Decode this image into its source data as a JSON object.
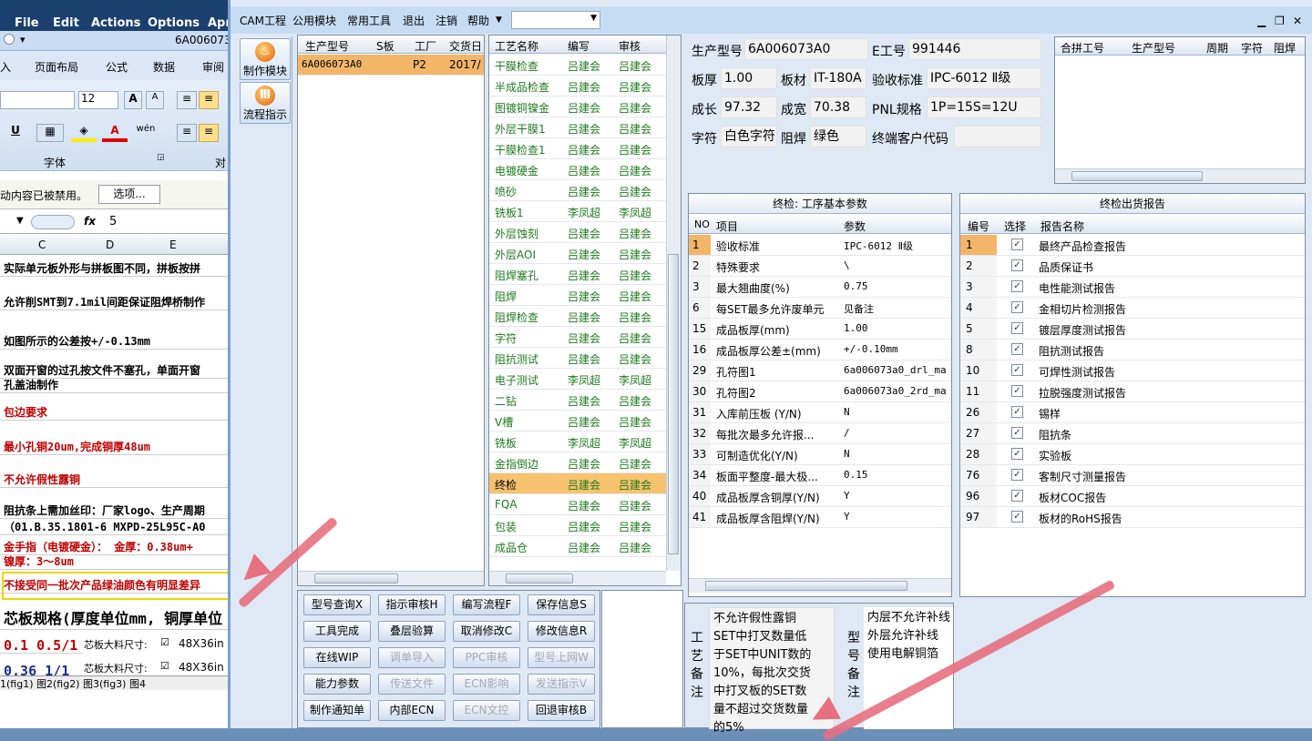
{
  "excel": {
    "menu": [
      "File",
      "Edit",
      "Actions",
      "Options",
      "Apr"
    ],
    "qat_title": "6A006073",
    "ribbon_tabs": [
      "入",
      "页面布局",
      "公式",
      "数据",
      "审阅"
    ],
    "font_size": "12",
    "group_font": "字体",
    "group_align": "对",
    "security_msg": "动内容已被禁用。",
    "options_btn": "选项...",
    "cell_value": "5",
    "fx": "fx",
    "columns": [
      "C",
      "D",
      "E"
    ],
    "rows": [
      {
        "text": "实际单元板外形与拼板图不同，拼板按拼",
        "red": false
      },
      {
        "text": "允许削SMT到7.1mil间距保证阻焊桥制作",
        "red": false
      },
      {
        "text": "如图所示的公差按+/-0.13mm",
        "red": false
      },
      {
        "text": "双面开窗的过孔按文件不塞孔，单面开窗",
        "red": false
      },
      {
        "text": "孔盖油制作",
        "red": false
      },
      {
        "text": "包边要求",
        "red": true
      },
      {
        "text": "最小孔铜20um,完成铜厚48um",
        "red": true
      },
      {
        "text": "不允许假性露铜",
        "red": true
      },
      {
        "text": "阻抗条上需加丝印：厂家logo、生产周期",
        "red": false
      },
      {
        "text": "（01.B.35.1801-6 MXPD-25L95C-A0",
        "red": false
      },
      {
        "text": "金手指（电镀硬金）： 金厚：0.38um+",
        "red": true
      },
      {
        "text": "镍厚：3～8um",
        "red": true
      },
      {
        "text": "不接受同一批次产品绿油颜色有明显差异",
        "red": true
      },
      {
        "text": "芯板规格(厚度单位mm, 铜厚单位",
        "red": false
      },
      {
        "text": "0.1  0.5/1",
        "red": true
      },
      {
        "text": "0.36 1/1",
        "red": false
      }
    ],
    "core_label": "芯板大料尺寸:",
    "core_val": "48X36in",
    "sheet_tabs": "1(fig1)  图2(fig2)  图3(fig3)  图4"
  },
  "cam": {
    "menu": [
      "CAM工程",
      "公用模块",
      "常用工具",
      "退出",
      "注销",
      "帮助"
    ],
    "toolbar": [
      {
        "label": "制作模块"
      },
      {
        "label": "流程指示"
      }
    ],
    "models": {
      "headers": [
        "生产型号",
        "S板",
        "工厂",
        "交货日"
      ],
      "rows": [
        {
          "model": "6A006073A0",
          "s": "",
          "factory": "P2",
          "date": "2017/"
        }
      ]
    },
    "process": {
      "headers": [
        "工艺名称",
        "编写",
        "审核"
      ],
      "rows": [
        [
          "干膜检查",
          "吕建会",
          "吕建会"
        ],
        [
          "半成品检查",
          "吕建会",
          "吕建会"
        ],
        [
          "图镀铜镍金",
          "吕建会",
          "吕建会"
        ],
        [
          "外层干膜1",
          "吕建会",
          "吕建会"
        ],
        [
          "干膜检查1",
          "吕建会",
          "吕建会"
        ],
        [
          "电镀硬金",
          "吕建会",
          "吕建会"
        ],
        [
          "喷砂",
          "吕建会",
          "吕建会"
        ],
        [
          "铣板1",
          "李凤超",
          "李凤超"
        ],
        [
          "外层蚀刻",
          "吕建会",
          "吕建会"
        ],
        [
          "外层AOI",
          "吕建会",
          "吕建会"
        ],
        [
          "阻焊塞孔",
          "吕建会",
          "吕建会"
        ],
        [
          "阻焊",
          "吕建会",
          "吕建会"
        ],
        [
          "阻焊检查",
          "吕建会",
          "吕建会"
        ],
        [
          "字符",
          "吕建会",
          "吕建会"
        ],
        [
          "阻抗测试",
          "吕建会",
          "吕建会"
        ],
        [
          "电子测试",
          "李凤超",
          "李凤超"
        ],
        [
          "二钻",
          "吕建会",
          "吕建会"
        ],
        [
          "V槽",
          "吕建会",
          "吕建会"
        ],
        [
          "铣板",
          "李凤超",
          "李凤超"
        ],
        [
          "金指倒边",
          "吕建会",
          "吕建会"
        ],
        [
          "终检",
          "吕建会",
          "吕建会"
        ],
        [
          "FQA",
          "吕建会",
          "吕建会"
        ],
        [
          "包装",
          "吕建会",
          "吕建会"
        ],
        [
          "成品仓",
          "吕建会",
          "吕建会"
        ]
      ],
      "selected_index": 20
    },
    "buttons": [
      [
        "型号查询X",
        "指示审核H",
        "编写流程F",
        "保存信息S"
      ],
      [
        "工具完成",
        "叠层验算",
        "取消修改C",
        "修改信息R"
      ],
      [
        "在线WIP",
        "调单导入",
        "PPC审核",
        "型号上网W"
      ],
      [
        "能力参数",
        "传送文件",
        "ECN影响",
        "发送指示V"
      ],
      [
        "制作通知单",
        "内部ECN",
        "ECN文控",
        "回退审核B"
      ]
    ],
    "disabled_buttons": [
      "调单导入",
      "PPC审核",
      "型号上网W",
      "传送文件",
      "ECN影响",
      "发送指示V",
      "ECN文控"
    ],
    "info": {
      "model_label": "生产型号",
      "model": "6A006073A0",
      "eng_label": "E工号",
      "eng": "991446",
      "thick_label": "板厚",
      "thick": "1.00",
      "material_label": "板材",
      "material": "IT-180A",
      "std_label": "验收标准",
      "std": "IPC-6012 Ⅱ级",
      "len_label": "成长",
      "len": "97.32",
      "wid_label": "成宽",
      "wid": "70.38",
      "pnl_label": "PNL规格",
      "pnl": "1P=15S=12U",
      "char_label": "字符",
      "char": "白色字符",
      "mask_label": "阻焊",
      "mask": "绿色",
      "cust_label": "终端客户代码",
      "cust": ""
    },
    "merge": {
      "headers": [
        "合拼工号",
        "生产型号",
        "周期",
        "字符",
        "阻焊"
      ]
    },
    "params": {
      "title": "终检: 工序基本参数",
      "headers": [
        "NO",
        "项目",
        "参数"
      ],
      "rows": [
        [
          "1",
          "验收标准",
          "IPC-6012 Ⅱ级"
        ],
        [
          "2",
          "特殊要求",
          "\\"
        ],
        [
          "3",
          "最大翘曲度(%)",
          "0.75"
        ],
        [
          "6",
          "每SET最多允许废单元",
          "见备注"
        ],
        [
          "15",
          "成品板厚(mm)",
          "1.00"
        ],
        [
          "16",
          "成品板厚公差±(mm)",
          "+/-0.10mm"
        ],
        [
          "29",
          "孔符图1",
          "6a006073a0_drl_ma"
        ],
        [
          "30",
          "孔符图2",
          "6a006073a0_2rd_ma"
        ],
        [
          "31",
          "入库前压板 (Y/N)",
          "N"
        ],
        [
          "32",
          "每批次最多允许报...",
          "/"
        ],
        [
          "33",
          "可制造优化(Y/N)",
          "N"
        ],
        [
          "34",
          "板面平整度-最大极...",
          "0.15"
        ],
        [
          "40",
          "成品板厚含铜厚(Y/N)",
          "Y"
        ],
        [
          "41",
          "成品板厚含阻焊(Y/N)",
          "Y"
        ]
      ]
    },
    "reports": {
      "title": "终检出货报告",
      "headers": [
        "编号",
        "选择",
        "报告名称"
      ],
      "rows": [
        [
          "1",
          "最终产品检查报告"
        ],
        [
          "2",
          "品质保证书"
        ],
        [
          "3",
          "电性能测试报告"
        ],
        [
          "4",
          "金相切片检测报告"
        ],
        [
          "5",
          "镀层厚度测试报告"
        ],
        [
          "8",
          "阻抗测试报告"
        ],
        [
          "10",
          "可焊性测试报告"
        ],
        [
          "11",
          "拉脱强度测试报告"
        ],
        [
          "26",
          "锡样"
        ],
        [
          "27",
          "阻抗条"
        ],
        [
          "28",
          "实验板"
        ],
        [
          "76",
          "客制尺寸测量报告"
        ],
        [
          "96",
          "板材COC报告"
        ],
        [
          "97",
          "板材的RoHS报告"
        ]
      ]
    },
    "process_remark_label": [
      "工",
      "艺",
      "备",
      "注"
    ],
    "process_remark": [
      "不允许假性露铜",
      "SET中打叉数量低",
      "于SET中UNIT数的",
      "10%，每批次交货",
      "中打叉板的SET数",
      "量不超过交货数量",
      "的5%"
    ],
    "model_remark_label": [
      "型",
      "号",
      "备",
      "注"
    ],
    "model_remark": [
      "内层不允许补线",
      "外层允许补线",
      "使用电解铜箔"
    ]
  }
}
